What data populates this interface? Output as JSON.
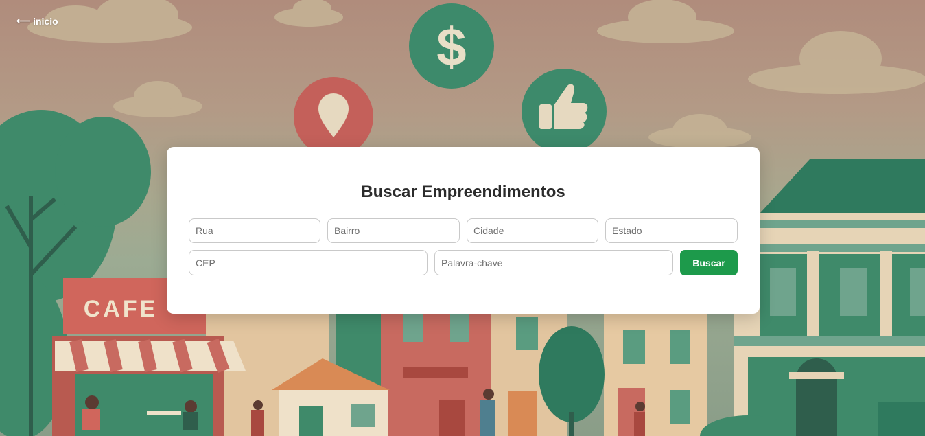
{
  "nav": {
    "back_label": "inicio",
    "back_icon": "arrow-left-icon"
  },
  "search": {
    "title": "Buscar Empreendimentos",
    "rua_placeholder": "Rua",
    "bairro_placeholder": "Bairro",
    "cidade_placeholder": "Cidade",
    "estado_placeholder": "Estado",
    "cep_placeholder": "CEP",
    "keyword_placeholder": "Palavra-chave",
    "submit_label": "Buscar"
  },
  "background": {
    "sign_text": "CAFE",
    "icons": [
      "dollar-icon",
      "map-pin-icon",
      "thumbs-up-icon"
    ]
  },
  "colors": {
    "accent": "#1d9a4b",
    "card": "#ffffff"
  }
}
